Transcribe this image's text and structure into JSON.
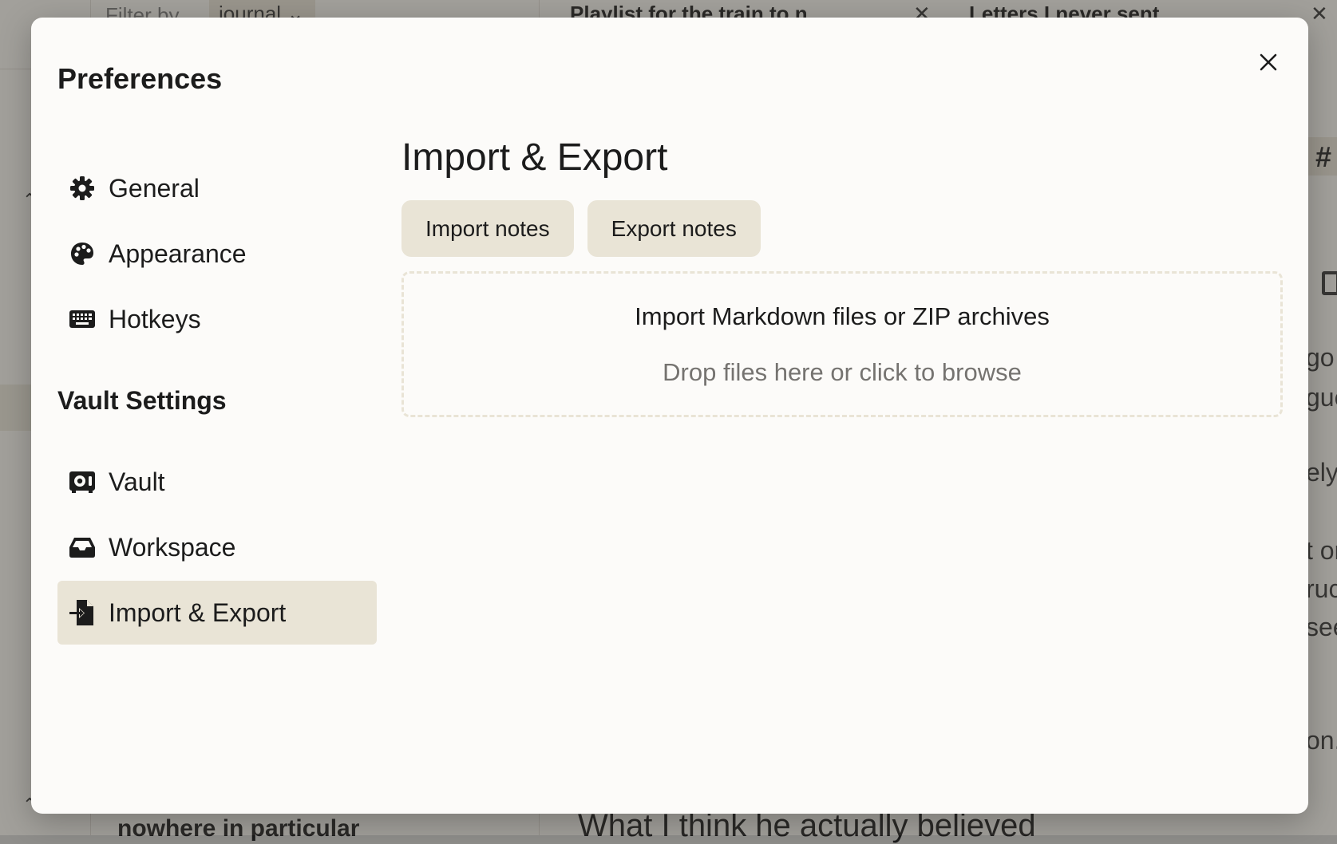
{
  "background": {
    "filter_label": "Filter by",
    "filter_value": "journal",
    "tab_1": "Playlist for the train to n",
    "tab_2": "Letters I never sent",
    "tab_close_glyph": "✕",
    "list_item_title": "nowhere in particular",
    "editor_heading": "What I think he actually believed",
    "tag_glyph": "#",
    "editor_fragments": [
      "go",
      "gue",
      "ely",
      "t or",
      "ruc",
      "see",
      "on."
    ]
  },
  "modal": {
    "title": "Preferences",
    "close_icon": "close-icon",
    "nav": {
      "items": [
        {
          "label": "General",
          "icon": "gear-icon"
        },
        {
          "label": "Appearance",
          "icon": "palette-icon"
        },
        {
          "label": "Hotkeys",
          "icon": "keyboard-icon"
        }
      ],
      "section_title": "Vault Settings",
      "vault_items": [
        {
          "label": "Vault",
          "icon": "vault-icon"
        },
        {
          "label": "Workspace",
          "icon": "inbox-icon"
        },
        {
          "label": "Import & Export",
          "icon": "file-import-icon",
          "active": true
        }
      ]
    },
    "content": {
      "title": "Import & Export",
      "import_button": "Import notes",
      "export_button": "Export notes",
      "dropzone_title": "Import Markdown files or ZIP archives",
      "dropzone_hint": "Drop files here or click to browse"
    }
  },
  "colors": {
    "modal_bg": "#fcfbf9",
    "accent_bg": "#e9e4d6",
    "text": "#1c1c1c",
    "muted_text": "#757370"
  }
}
